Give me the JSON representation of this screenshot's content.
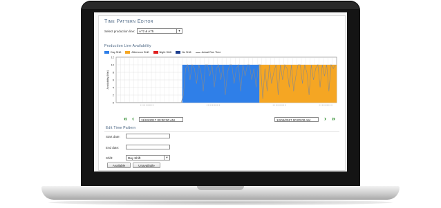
{
  "app": {
    "title": "Time Pattern Editor",
    "production_line_label": "Select production line:",
    "production_line_value": "A72 & A75"
  },
  "availability": {
    "section_title": "Production Line Availability",
    "legend": [
      {
        "label": "Day Shift",
        "color": "#2f7fe8"
      },
      {
        "label": "Afternoon Shift",
        "color": "#f5a623"
      },
      {
        "label": "Night Shift",
        "color": "#e02020"
      },
      {
        "label": "No Shift",
        "color": "#1d3f8f"
      },
      {
        "label": "Actual Run Time",
        "color": "#8a8a8a",
        "style": "line"
      }
    ]
  },
  "chart_data": {
    "type": "area",
    "ylabel": "Availability [Min]",
    "xlabel": "Time in 10 Min Intervals",
    "ylim": [
      0,
      12
    ],
    "y_ticks": [
      0,
      2,
      4,
      6,
      8,
      10,
      12
    ],
    "x_tick_labels": [
      "11/04/2017",
      "11/04/2017",
      "11/04/2017",
      "11/04/2017"
    ],
    "n_intervals": 100,
    "shift_blocks": [
      {
        "shift": "Day Shift",
        "from_interval": 31,
        "to_interval": 65,
        "value": 10,
        "color": "#2f7fe8"
      },
      {
        "shift": "Afternoon Shift",
        "from_interval": 66,
        "to_interval": 100,
        "value": 10,
        "color": "#f5a623"
      }
    ],
    "actual_run_time": [
      0,
      0,
      0,
      0,
      0,
      0,
      0,
      0,
      0,
      0,
      0,
      0,
      0,
      0,
      0,
      0,
      0,
      0,
      0,
      0,
      0,
      0,
      0,
      0,
      0,
      0,
      0,
      0,
      0,
      0,
      2,
      9,
      10,
      6,
      10,
      9,
      5,
      10,
      8,
      3,
      10,
      10,
      7,
      10,
      4,
      9,
      10,
      6,
      10,
      2,
      8,
      10,
      10,
      5,
      9,
      10,
      3,
      10,
      7,
      10,
      10,
      6,
      9,
      4,
      10,
      10,
      1,
      9,
      3,
      10,
      5,
      8,
      10,
      2,
      10,
      6,
      10,
      9,
      4,
      10,
      3,
      7,
      10,
      10,
      5,
      10,
      8,
      2,
      10,
      6,
      9,
      10,
      4,
      10,
      7,
      10,
      3,
      10,
      9,
      10
    ],
    "grid": true
  },
  "navigation": {
    "start_datetime": "11/04/2017 00:00:00 AM",
    "end_datetime": "12/04/2017 00:00:00 AM",
    "first_icon": "double-chevron-left-icon",
    "prev_icon": "chevron-left-icon",
    "next_icon": "chevron-right-icon",
    "last_icon": "double-chevron-right-icon",
    "first_glyph": "«",
    "prev_glyph": "‹",
    "next_glyph": "›",
    "last_glyph": "»"
  },
  "edit": {
    "section_title": "Edit Time Pattern",
    "start_date_label": "Start date:",
    "end_date_label": "End date:",
    "shift_label": "Shift:",
    "shift_value": "Day Shift",
    "available_button": "Available",
    "unavailable_button": "Unavailable"
  }
}
